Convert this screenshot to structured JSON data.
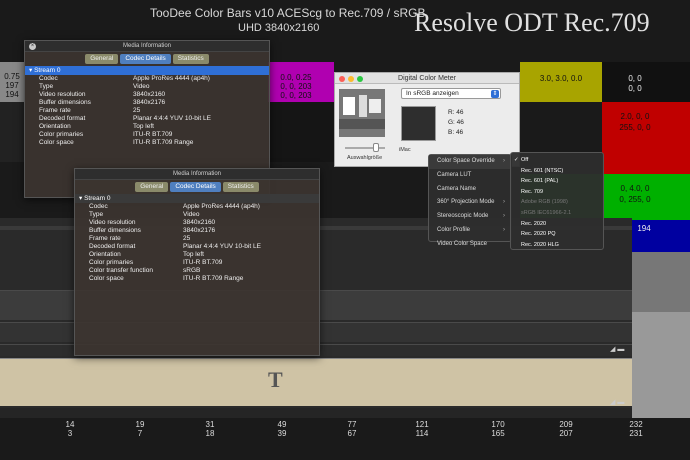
{
  "header": {
    "title_line1": "TooDee Color Bars v10 ACEScg to Rec.709 / sRGB",
    "title_line2": "UHD 3840x2160",
    "odt_label": "Resolve ODT Rec.709"
  },
  "bars": {
    "left_top": [
      "0.75",
      "197",
      "194"
    ],
    "magenta_top": [
      "0.0, 0.25",
      "0, 0, 203",
      "0, 0, 203"
    ],
    "yellow_top": "3.0, 3.0, 0.0",
    "black_top": [
      "0, 0",
      "0, 0"
    ],
    "red_right": [
      "2.0, 0, 0",
      "255, 0, 0"
    ],
    "green_right": [
      "0, 4.0, 0",
      "0, 255, 0"
    ],
    "ruler_right": "194",
    "bottom_cols": [
      {
        "a": "14",
        "b": "3"
      },
      {
        "a": "19",
        "b": "7"
      },
      {
        "a": "31",
        "b": "18"
      },
      {
        "a": "49",
        "b": "39"
      },
      {
        "a": "77",
        "b": "67"
      },
      {
        "a": "121",
        "b": "114"
      },
      {
        "a": "170",
        "b": "165"
      },
      {
        "a": "209",
        "b": "207"
      },
      {
        "a": "232",
        "b": "231"
      }
    ]
  },
  "media_info_1": {
    "title": "Media Information",
    "tabs": [
      "General",
      "Codec Details",
      "Statistics"
    ],
    "active_tab": "Codec Details",
    "stream": "Stream 0",
    "rows": [
      {
        "k": "Codec",
        "v": "Apple ProRes 4444 (ap4h)"
      },
      {
        "k": "Type",
        "v": "Video"
      },
      {
        "k": "Video resolution",
        "v": "3840x2160"
      },
      {
        "k": "Buffer dimensions",
        "v": "3840x2176"
      },
      {
        "k": "Frame rate",
        "v": "25"
      },
      {
        "k": "Decoded format",
        "v": "Planar 4:4:4 YUV 10-bit LE"
      },
      {
        "k": "Orientation",
        "v": "Top left"
      },
      {
        "k": "Color primaries",
        "v": "ITU-R BT.709"
      },
      {
        "k": "Color space",
        "v": "ITU-R BT.709 Range"
      }
    ]
  },
  "media_info_2": {
    "title": "Media Information",
    "tabs": [
      "General",
      "Codec Details",
      "Statistics"
    ],
    "active_tab": "Codec Details",
    "stream": "Stream 0",
    "rows": [
      {
        "k": "Codec",
        "v": "Apple ProRes 4444 (ap4h)"
      },
      {
        "k": "Type",
        "v": "Video"
      },
      {
        "k": "Video resolution",
        "v": "3840x2160"
      },
      {
        "k": "Buffer dimensions",
        "v": "3840x2176"
      },
      {
        "k": "Frame rate",
        "v": "25"
      },
      {
        "k": "Decoded format",
        "v": "Planar 4:4:4 YUV 10-bit LE"
      },
      {
        "k": "Orientation",
        "v": "Top left"
      },
      {
        "k": "Color primaries",
        "v": "ITU-R BT.709"
      },
      {
        "k": "Color transfer function",
        "v": "sRGB"
      },
      {
        "k": "Color space",
        "v": "ITU-R BT.709 Range"
      }
    ]
  },
  "color_meter": {
    "title": "Digital Color Meter",
    "mode": "In sRGB anzeigen",
    "r": "R: 46",
    "g": "G: 46",
    "b": "B: 46",
    "size_label": "Auswahlgröße",
    "display_label": "iMac"
  },
  "context_menu": {
    "items": [
      "Color Space Override",
      "Camera LUT",
      "Camera Name",
      "360° Projection Mode",
      "Stereoscopic Mode",
      "Color Profile",
      "Video Color Space"
    ]
  },
  "submenu": {
    "items": [
      {
        "label": "Off",
        "checked": true,
        "disabled": false
      },
      {
        "label": "Rec. 601 (NTSC)",
        "checked": false,
        "disabled": false
      },
      {
        "label": "Rec. 601 (PAL)",
        "checked": false,
        "disabled": false
      },
      {
        "label": "Rec. 709",
        "checked": false,
        "disabled": false
      },
      {
        "label": "Adobe RGB (1998)",
        "checked": false,
        "disabled": true
      },
      {
        "label": "sRGB IEC61966-2.1",
        "checked": false,
        "disabled": true
      },
      {
        "label": "Rec. 2020",
        "checked": false,
        "disabled": false
      },
      {
        "label": "Rec. 2020 PQ",
        "checked": false,
        "disabled": false
      },
      {
        "label": "Rec. 2020 HLG",
        "checked": false,
        "disabled": false
      }
    ]
  },
  "timeline": {
    "title_clip": "T"
  },
  "colors": {
    "magenta": "#b000b0",
    "yellow": "#a8a400",
    "red": "#c00000",
    "green": "#00a000",
    "blue": "#0000a0"
  }
}
